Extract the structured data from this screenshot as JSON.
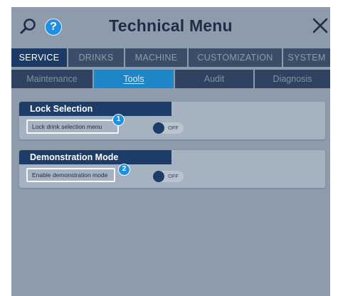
{
  "header": {
    "title": "Technical Menu",
    "search_icon": "search-icon",
    "help_icon": "help-icon",
    "help_glyph": "?",
    "close_icon": "close-icon"
  },
  "main_tabs": [
    {
      "label": "SERVICE",
      "active": true
    },
    {
      "label": "DRINKS",
      "active": false
    },
    {
      "label": "MACHINE",
      "active": false
    },
    {
      "label": "CUSTOMIZATION",
      "active": false
    },
    {
      "label": "SYSTEM",
      "active": false
    }
  ],
  "sub_tabs": [
    {
      "label": "Maintenance",
      "active": false
    },
    {
      "label": "Tools",
      "active": true
    },
    {
      "label": "Audit",
      "active": false
    },
    {
      "label": "Diagnosis",
      "active": false
    }
  ],
  "settings": [
    {
      "section_title": "Lock Selection",
      "label": "Lock drink selection menu",
      "callout": "1",
      "toggle_state": "OFF"
    },
    {
      "section_title": "Demonstration Mode",
      "label": "Enable demonstration mode",
      "callout": "2",
      "toggle_state": "OFF"
    }
  ],
  "colors": {
    "background": "#8d9bab",
    "header_dark": "#1d3c68",
    "accent_blue": "#1c86c7",
    "callout_blue": "#1f8fe0"
  }
}
